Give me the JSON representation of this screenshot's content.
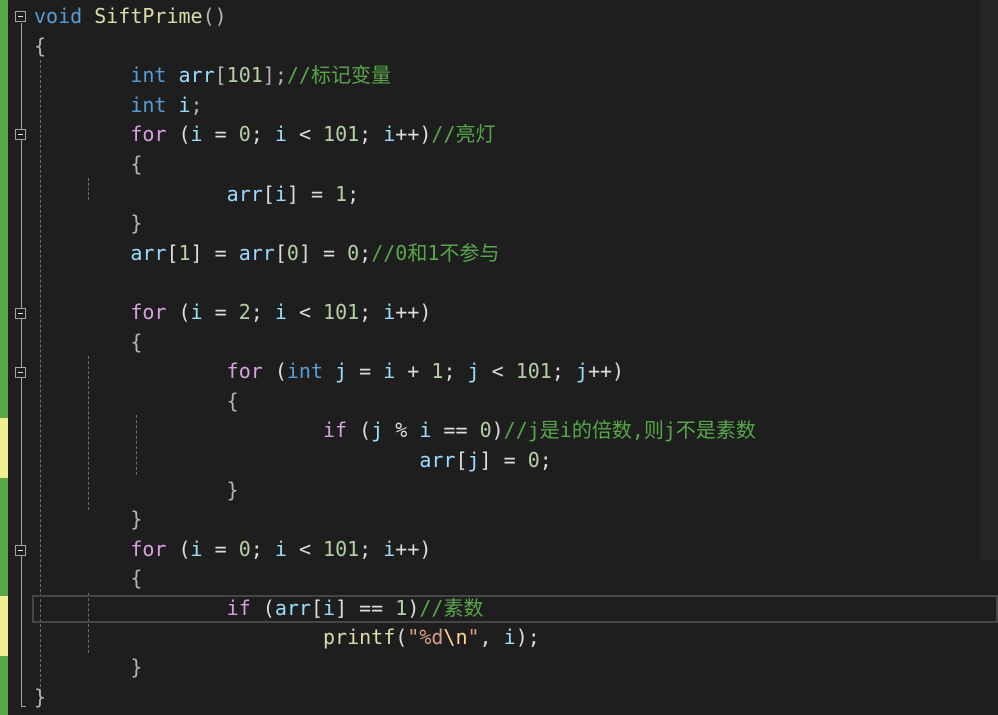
{
  "editor": {
    "language": "C",
    "colors": {
      "background": "#1e1e1e",
      "keyword": "#569cd6",
      "control": "#d8a0df",
      "number": "#b5cea8",
      "comment": "#57a64a",
      "string": "#d69d85",
      "variable": "#9cdcfe",
      "function": "#dcdcaa",
      "margin_saved": "#57a64a",
      "margin_unsaved": "#efef91"
    },
    "collapse_icon": "minus-box-icon",
    "code": {
      "l1": {
        "kw": "void",
        "sp": " ",
        "name": "SiftPrime",
        "paren": "()"
      },
      "l2": {
        "brace": "{"
      },
      "l3": {
        "indent": "        ",
        "kw": "int",
        "sp": " ",
        "var": "arr",
        "b1": "[",
        "num": "101",
        "b2": "];",
        "cm": "//标记变量"
      },
      "l4": {
        "indent": "        ",
        "kw": "int",
        "sp": " ",
        "var": "i",
        "semi": ";"
      },
      "l5": {
        "indent": "        ",
        "ctl": "for",
        "t1": " (",
        "v1": "i",
        "t2": " = ",
        "n1": "0",
        "t3": "; ",
        "v2": "i",
        "t4": " < ",
        "n2": "101",
        "t5": "; ",
        "v3": "i",
        "t6": "++)",
        "cm": "//亮灯"
      },
      "l6": {
        "indent": "        ",
        "brace": "{"
      },
      "l7": {
        "indent": "                ",
        "v1": "arr",
        "t1": "[",
        "v2": "i",
        "t2": "] = ",
        "n1": "1",
        "t3": ";"
      },
      "l8": {
        "indent": "        ",
        "brace": "}"
      },
      "l9": {
        "indent": "        ",
        "v1": "arr",
        "t1": "[",
        "n1": "1",
        "t2": "] = ",
        "v2": "arr",
        "t3": "[",
        "n2": "0",
        "t4": "] = ",
        "n3": "0",
        "t5": ";",
        "cm": "//0和1不参与"
      },
      "l10": {
        "text": ""
      },
      "l11": {
        "indent": "        ",
        "ctl": "for",
        "t1": " (",
        "v1": "i",
        "t2": " = ",
        "n1": "2",
        "t3": "; ",
        "v2": "i",
        "t4": " < ",
        "n2": "101",
        "t5": "; ",
        "v3": "i",
        "t6": "++)"
      },
      "l12": {
        "indent": "        ",
        "brace": "{"
      },
      "l13": {
        "indent": "                ",
        "ctl": "for",
        "t1": " (",
        "kw": "int",
        "t2": " ",
        "v1": "j",
        "t3": " = ",
        "v2": "i",
        "t4": " + ",
        "n1": "1",
        "t5": "; ",
        "v3": "j",
        "t6": " < ",
        "n2": "101",
        "t7": "; ",
        "v4": "j",
        "t8": "++)"
      },
      "l14": {
        "indent": "                ",
        "brace": "{"
      },
      "l15": {
        "indent": "                        ",
        "ctl": "if",
        "t1": " (",
        "v1": "j",
        "t2": " % ",
        "v2": "i",
        "t3": " == ",
        "n1": "0",
        "t4": ")",
        "cm": "//j是i的倍数,则j不是素数"
      },
      "l16": {
        "indent": "                                ",
        "v1": "arr",
        "t1": "[",
        "v2": "j",
        "t2": "] = ",
        "n1": "0",
        "t3": ";"
      },
      "l17": {
        "indent": "                ",
        "brace": "}"
      },
      "l18": {
        "indent": "        ",
        "brace": "}"
      },
      "l19": {
        "indent": "        ",
        "ctl": "for",
        "t1": " (",
        "v1": "i",
        "t2": " = ",
        "n1": "0",
        "t3": "; ",
        "v2": "i",
        "t4": " < ",
        "n2": "101",
        "t5": "; ",
        "v3": "i",
        "t6": "++)"
      },
      "l20": {
        "indent": "        ",
        "brace": "{"
      },
      "l21": {
        "indent": "                ",
        "ctl": "if",
        "t1": " (",
        "v1": "arr",
        "t2": "[",
        "v2": "i",
        "t3": "] == ",
        "n1": "1",
        "t4": ")",
        "cm": "//素数"
      },
      "l22": {
        "indent": "                        ",
        "fn": "printf",
        "t1": "(",
        "q1": "\"%d",
        "esc": "\\n",
        "q2": "\"",
        "t2": ", ",
        "v1": "i",
        "t3": ");"
      },
      "l23": {
        "indent": "        ",
        "brace": "}"
      },
      "l24": {
        "brace": "}"
      }
    }
  }
}
